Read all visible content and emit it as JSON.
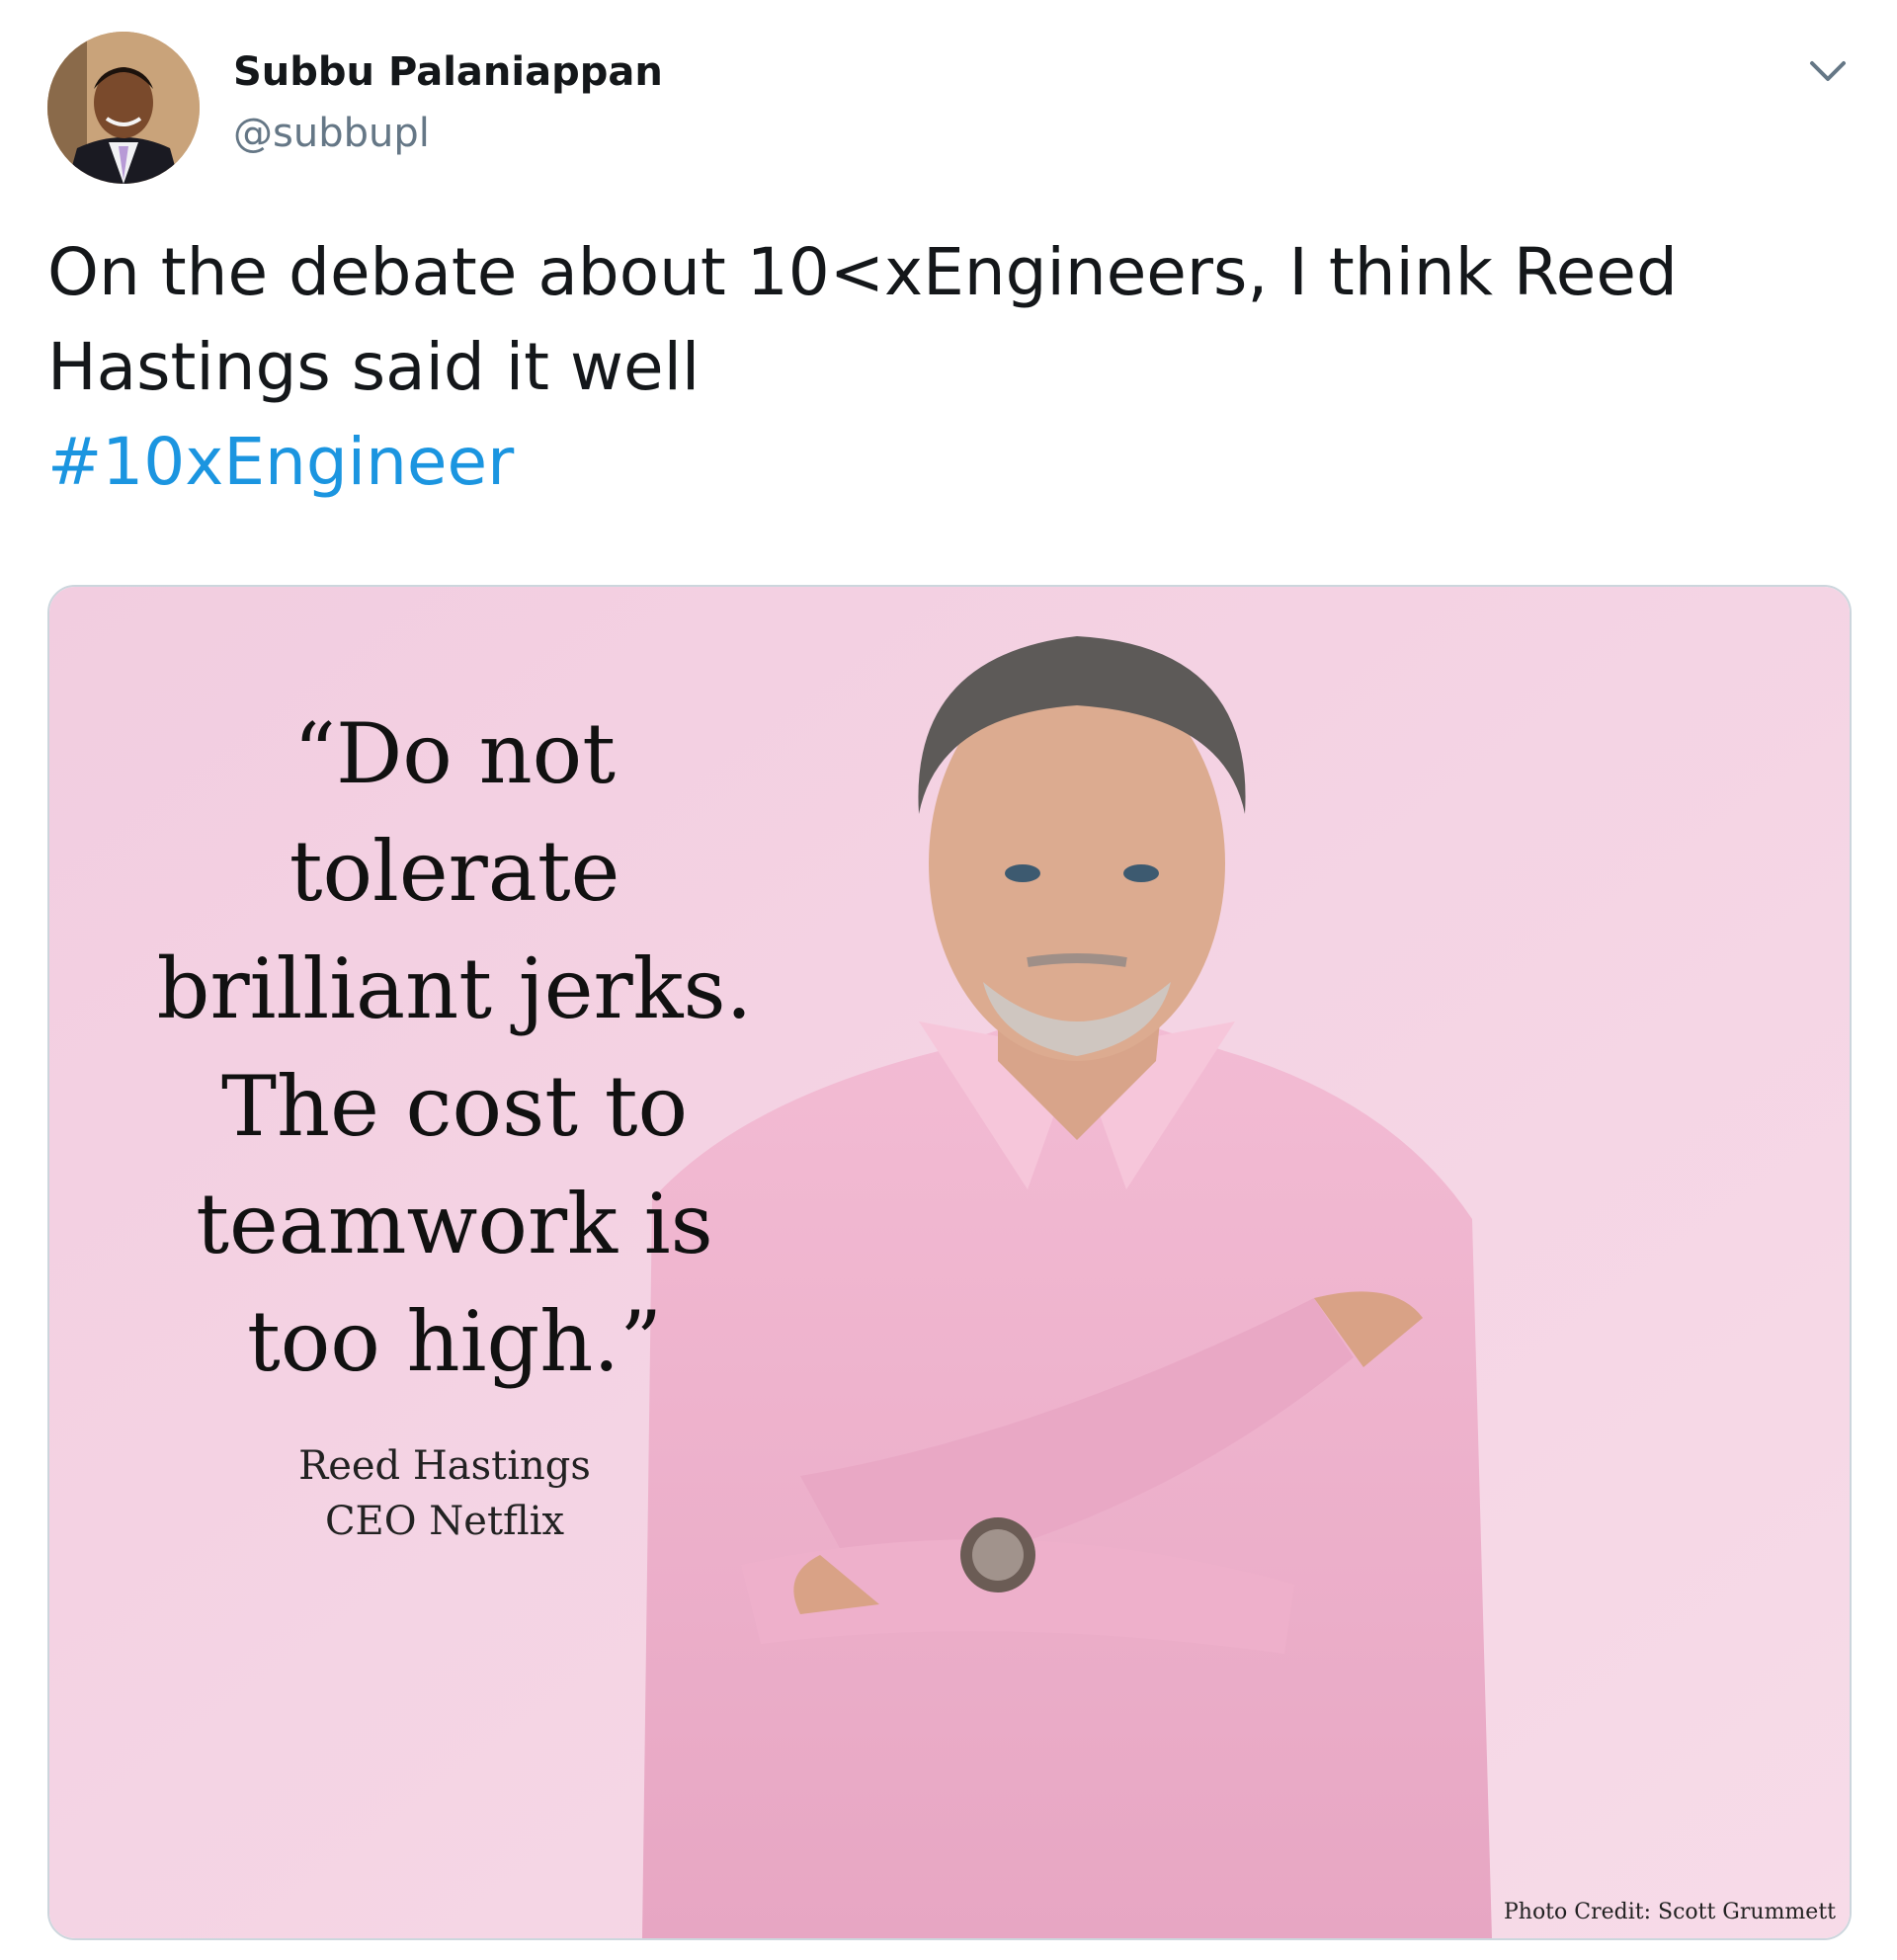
{
  "tweet": {
    "author": {
      "display_name": "Subbu Palaniappan",
      "handle": "@subbupl"
    },
    "text_lines": [
      "On the debate about 10<xEngineers, I think Reed",
      "Hastings said it well"
    ],
    "hashtag": "#10xEngineer",
    "menu_icon": "chevron-down-icon",
    "colors": {
      "hashtag": "#1b95e0",
      "handle": "#657786",
      "text": "#14171a",
      "media_background": "#f2cde0",
      "shirt": "#efb2cd"
    }
  },
  "media": {
    "quote_lines": [
      "“Do not",
      "tolerate",
      "brilliant jerks.",
      "The cost to",
      "teamwork is",
      "too high.”"
    ],
    "attribution_name": "Reed Hastings",
    "attribution_title": "CEO Netflix",
    "photo_credit": "Photo Credit: Scott Grummett"
  }
}
